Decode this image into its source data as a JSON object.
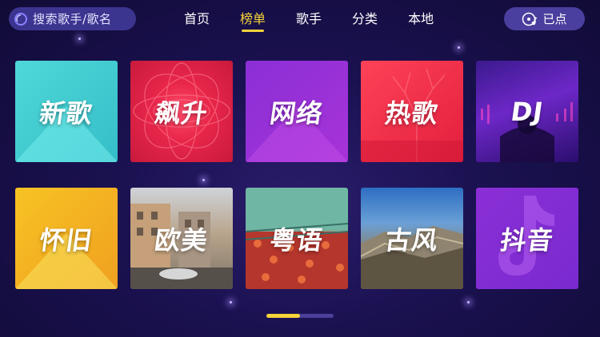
{
  "search": {
    "placeholder": "搜索歌手/歌名"
  },
  "nav": {
    "tabs": [
      {
        "label": "首页",
        "active": false
      },
      {
        "label": "榜单",
        "active": true
      },
      {
        "label": "歌手",
        "active": false
      },
      {
        "label": "分类",
        "active": false
      },
      {
        "label": "本地",
        "active": false
      }
    ]
  },
  "picked": {
    "label": "已点",
    "icon": "disc-music-icon"
  },
  "tiles": [
    {
      "label": "新歌"
    },
    {
      "label": "飙升"
    },
    {
      "label": "网络"
    },
    {
      "label": "热歌"
    },
    {
      "label": "DJ"
    },
    {
      "label": "怀旧"
    },
    {
      "label": "欧美"
    },
    {
      "label": "粤语"
    },
    {
      "label": "古风"
    },
    {
      "label": "抖音"
    }
  ],
  "pager": {
    "page": 1,
    "total_pages": 2,
    "progress": 0.5
  },
  "colors": {
    "accent": "#f6d33a",
    "background": "#1a1150",
    "pill": "#3b3590"
  }
}
